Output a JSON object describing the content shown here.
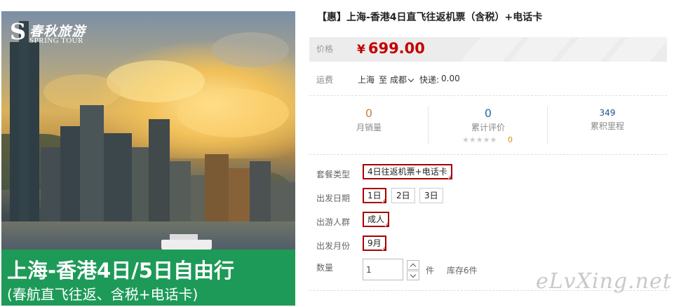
{
  "image": {
    "logo_cn": "春秋旅游",
    "logo_en": "SPRING TOUR",
    "banner_title": "上海-香港4日/5日自由行",
    "banner_subtitle": "(春航直飞往返、含税+电话卡)",
    "banner_color": "#1e9a58"
  },
  "product": {
    "title": "【惠】上海-香港4日直飞往返机票（含税）+电话卡",
    "price_label": "价格",
    "currency": "¥",
    "price": "699.00",
    "price_color": "#c40000"
  },
  "shipping": {
    "label": "运费",
    "from": "上海",
    "to_word": "至",
    "destination": "成都",
    "fee_label": "快递:",
    "fee": "0.00"
  },
  "stats": {
    "monthly_sales": {
      "value": "0",
      "label": "月销量",
      "color": "#c7813a"
    },
    "reviews": {
      "value": "0",
      "label": "累计评价",
      "color": "#1f6dab",
      "stars": "★★★★★",
      "count": "0",
      "rating": 0
    },
    "points": {
      "value": "349",
      "label": "累积里程",
      "color": "#1f4e8c"
    }
  },
  "options": {
    "package": {
      "label": "套餐类型",
      "choices": [
        "4日往返机票+电话卡"
      ],
      "selected": "4日往返机票+电话卡"
    },
    "departure_date": {
      "label": "出发日期",
      "choices": [
        "1日",
        "2日",
        "3日"
      ],
      "selected": "1日"
    },
    "travelers": {
      "label": "出游人群",
      "choices": [
        "成人"
      ],
      "selected": "成人"
    },
    "departure_month": {
      "label": "出发月份",
      "choices": [
        "9月"
      ],
      "selected": "9月"
    }
  },
  "quantity": {
    "label": "数量",
    "value": "1",
    "unit": "件",
    "stock": "库存6件"
  },
  "watermark": "eLvXing.net",
  "accent_selected": "#a80000"
}
